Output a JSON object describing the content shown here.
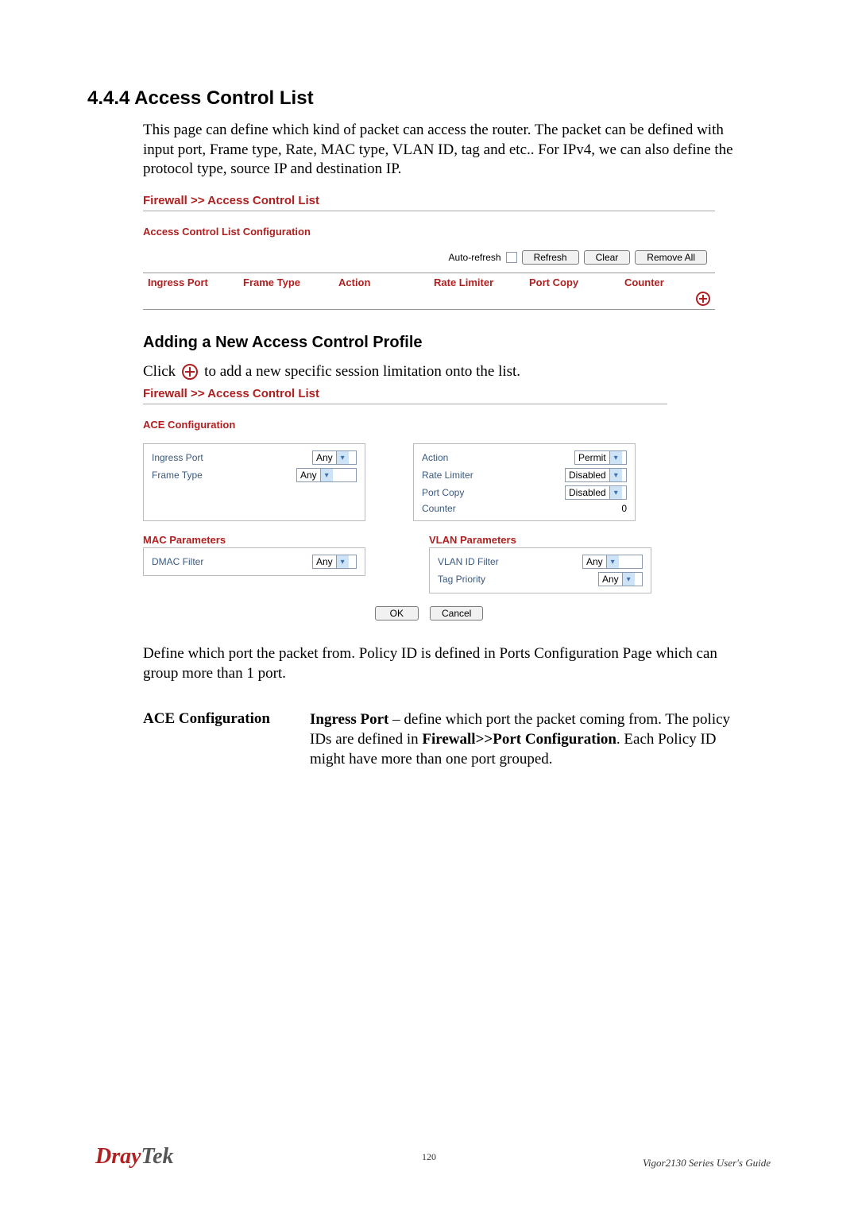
{
  "section": {
    "number": "4.4.4",
    "title": "Access Control List",
    "intro": "This page can define which kind of packet can access the router. The packet can be defined with input port, Frame type, Rate, MAC type, VLAN ID, tag and etc.. For IPv4, we can also define the protocol type, source IP and destination IP."
  },
  "ui1": {
    "breadcrumb": "Firewall >> Access Control List",
    "subtitle": "Access Control List Configuration",
    "toolbar": {
      "auto_refresh_label": "Auto-refresh",
      "refresh": "Refresh",
      "clear": "Clear",
      "remove_all": "Remove All"
    },
    "headers": {
      "ingress_port": "Ingress Port",
      "frame_type": "Frame Type",
      "action": "Action",
      "rate_limiter": "Rate Limiter",
      "port_copy": "Port Copy",
      "counter": "Counter"
    }
  },
  "subsection": {
    "title": "Adding a New Access Control Profile",
    "click_text_before": "Click",
    "click_text_after": "to add a new specific session limitation onto the list."
  },
  "ui2": {
    "breadcrumb": "Firewall >> Access Control List",
    "ace_title": "ACE Configuration",
    "left": {
      "ingress_port": {
        "label": "Ingress Port",
        "value": "Any"
      },
      "frame_type": {
        "label": "Frame Type",
        "value": "Any"
      }
    },
    "right": {
      "action": {
        "label": "Action",
        "value": "Permit"
      },
      "rate_limiter": {
        "label": "Rate Limiter",
        "value": "Disabled"
      },
      "port_copy": {
        "label": "Port Copy",
        "value": "Disabled"
      },
      "counter": {
        "label": "Counter",
        "value": "0"
      }
    },
    "mac": {
      "title": "MAC Parameters",
      "dmac_filter": {
        "label": "DMAC Filter",
        "value": "Any"
      }
    },
    "vlan": {
      "title": "VLAN Parameters",
      "vlan_id_filter": {
        "label": "VLAN ID Filter",
        "value": "Any"
      },
      "tag_priority": {
        "label": "Tag Priority",
        "value": "Any"
      }
    },
    "buttons": {
      "ok": "OK",
      "cancel": "Cancel"
    }
  },
  "paragraph2": "Define which port the packet from. Policy ID is defined in Ports Configuration Page which can group more than 1 port.",
  "definition": {
    "term": "ACE Configuration",
    "body_lead": "Ingress Port",
    "body_rest1": " – define which port the packet coming from. The policy IDs are defined in ",
    "body_bold": "Firewall>>Port Configuration",
    "body_rest2": ". Each Policy ID might have more than one port grouped."
  },
  "footer": {
    "page": "120",
    "guide": "Vigor2130  Series  User's  Guide",
    "logo": {
      "dray": "Dray",
      "tek": "Tek"
    }
  }
}
